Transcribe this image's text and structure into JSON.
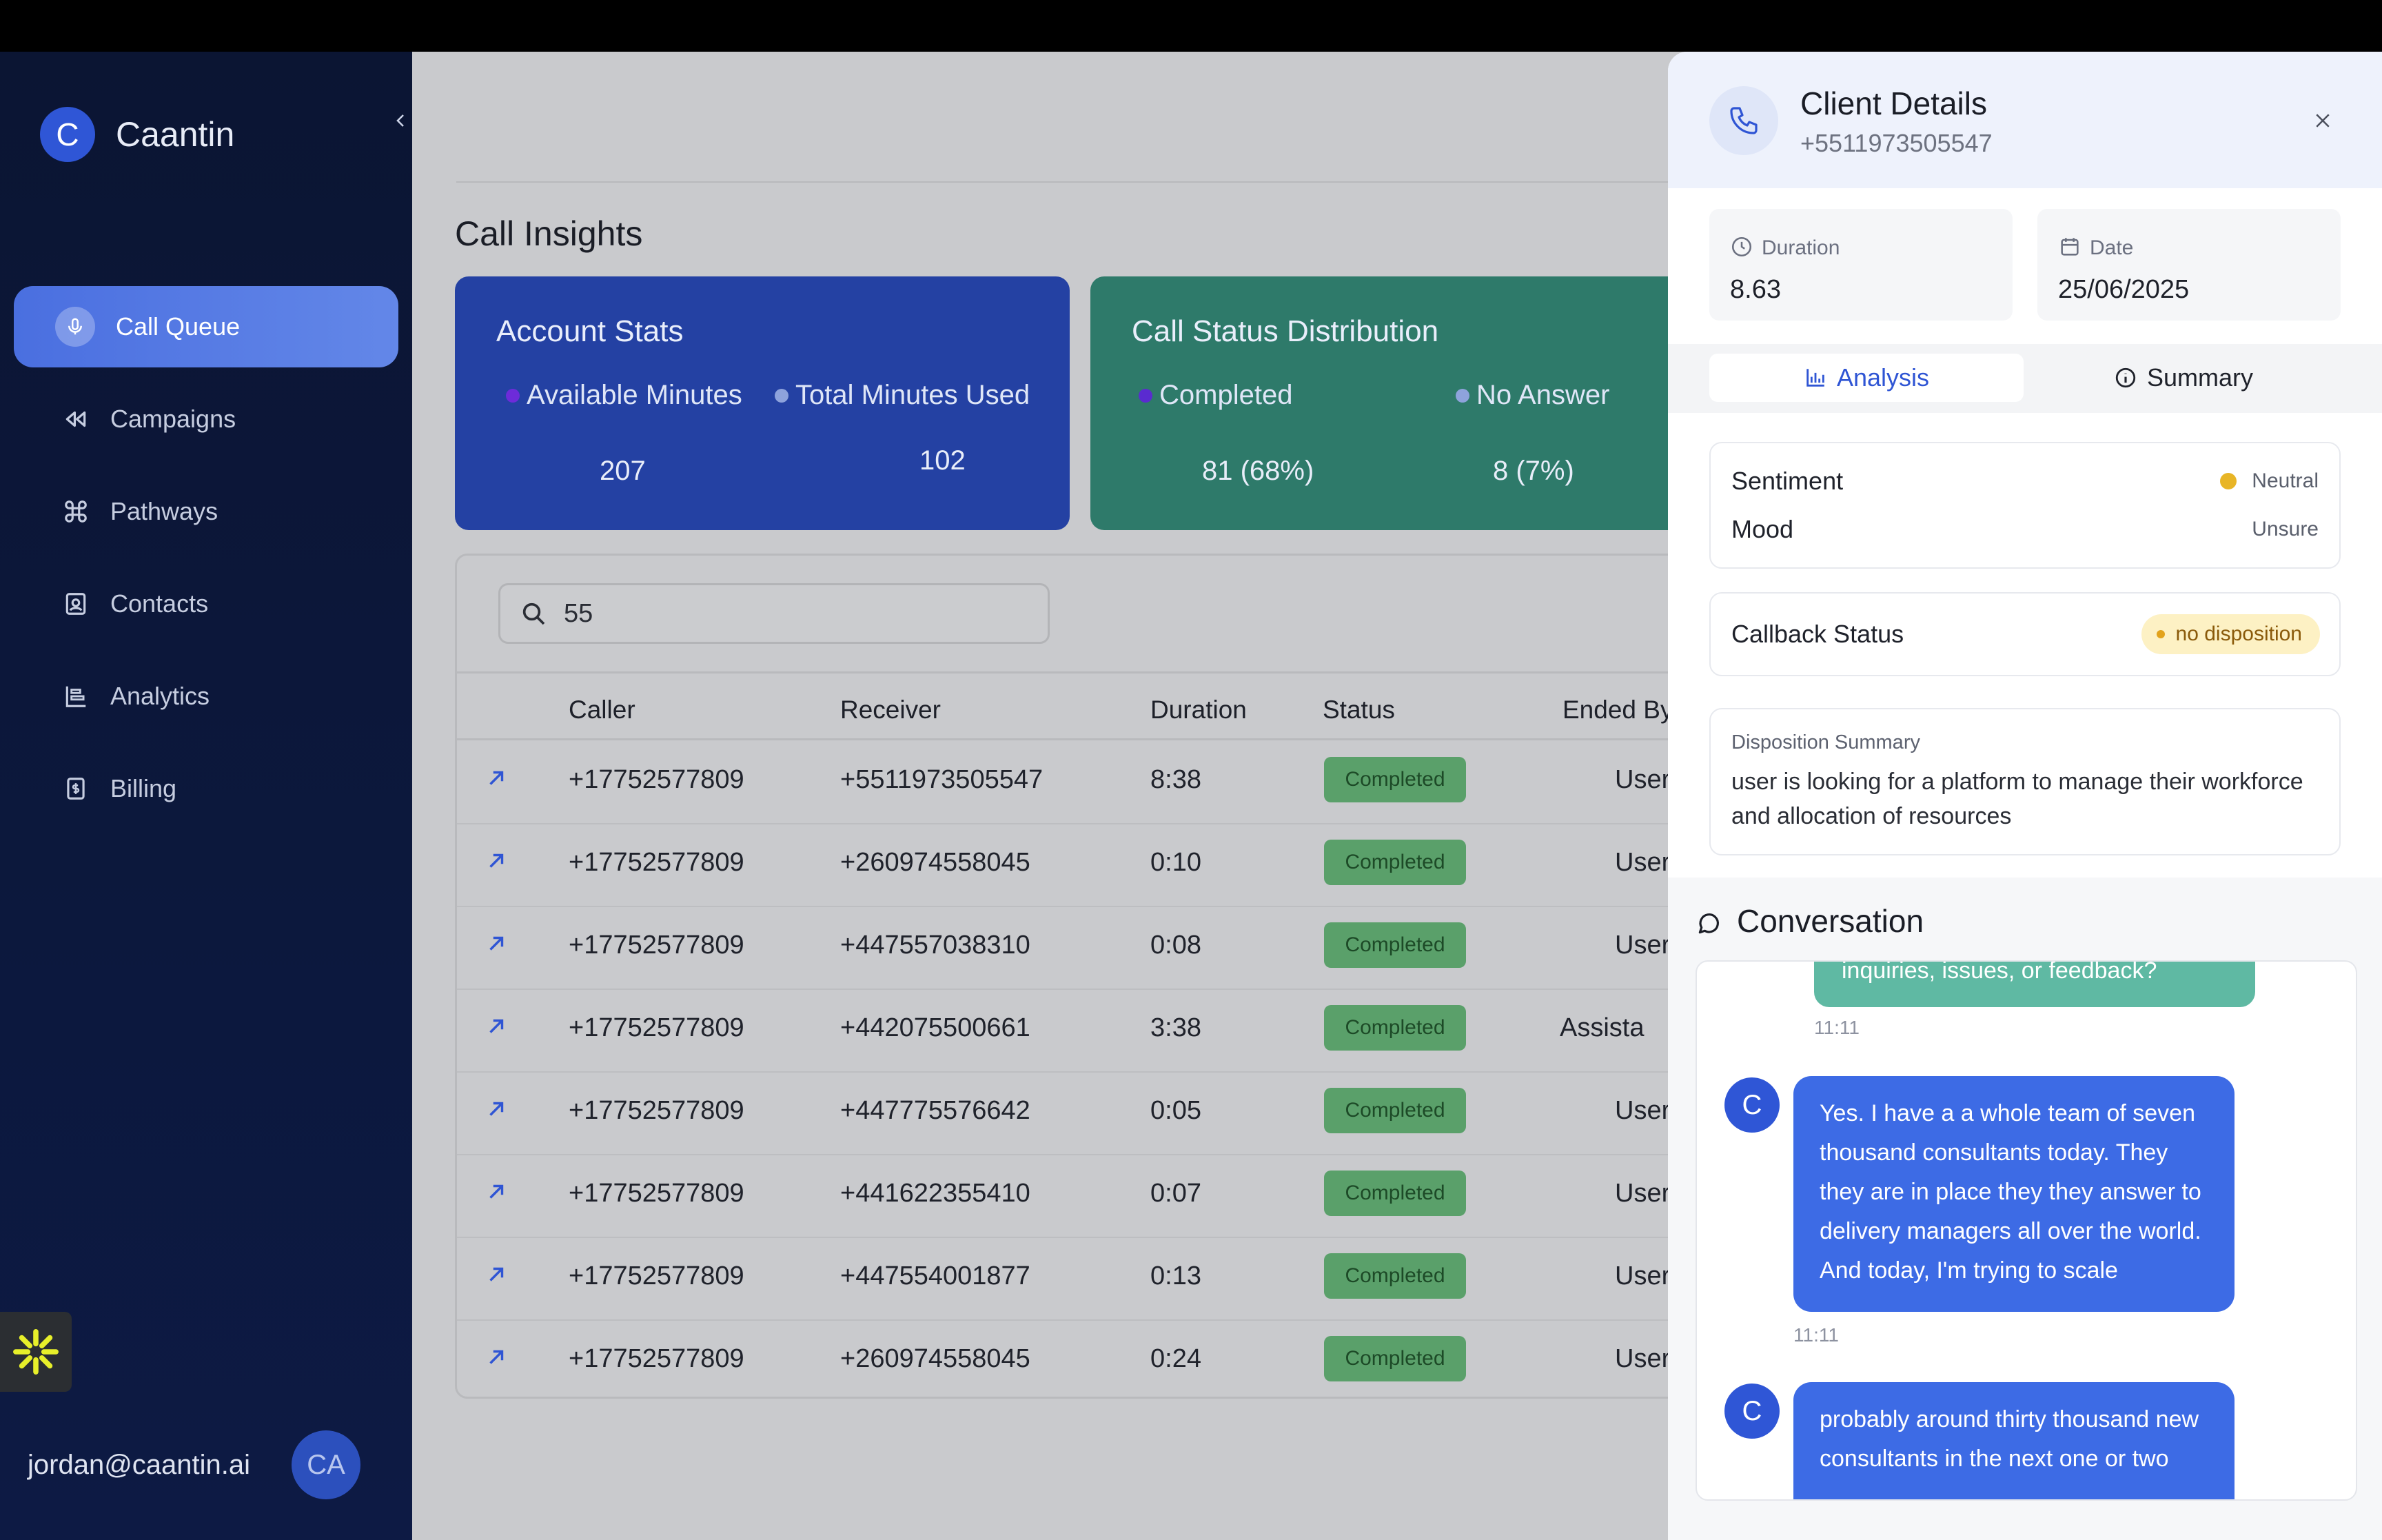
{
  "app": {
    "brand_initial": "C",
    "brand_name": "Caantin"
  },
  "sidebar": {
    "items": [
      {
        "label": "Call Queue",
        "icon": "mic-icon",
        "active": true
      },
      {
        "label": "Campaigns",
        "icon": "rewind-icon"
      },
      {
        "label": "Pathways",
        "icon": "command-icon"
      },
      {
        "label": "Contacts",
        "icon": "contact-card-icon"
      },
      {
        "label": "Analytics",
        "icon": "analytics-icon"
      },
      {
        "label": "Billing",
        "icon": "billing-icon"
      }
    ],
    "user_email": "jordan@caantin.ai",
    "user_initials": "CA"
  },
  "main": {
    "title": "Call Insights",
    "account_stats": {
      "title": "Account Stats",
      "legend": [
        {
          "label": "Available Minutes",
          "color": "#6d2bd9"
        },
        {
          "label": "Total Minutes Used",
          "color": "#8ea3dc"
        }
      ],
      "values": [
        "207",
        "102"
      ]
    },
    "call_status": {
      "title": "Call Status Distribution",
      "legend": [
        {
          "label": "Completed",
          "color": "#5a2bd0"
        },
        {
          "label": "No Answer",
          "color": "#8ea3dc"
        }
      ],
      "values": [
        "81 (68%)",
        "8 (7%)"
      ]
    },
    "search": {
      "value": "55"
    },
    "table": {
      "headers": [
        "Caller",
        "Receiver",
        "Duration",
        "Status",
        "Ended By"
      ],
      "rows": [
        {
          "caller": "+17752577809",
          "receiver": "+5511973505547",
          "duration": "8:38",
          "status": "Completed",
          "ended_by": "User"
        },
        {
          "caller": "+17752577809",
          "receiver": "+260974558045",
          "duration": "0:10",
          "status": "Completed",
          "ended_by": "User"
        },
        {
          "caller": "+17752577809",
          "receiver": "+447557038310",
          "duration": "0:08",
          "status": "Completed",
          "ended_by": "User"
        },
        {
          "caller": "+17752577809",
          "receiver": "+442075500661",
          "duration": "3:38",
          "status": "Completed",
          "ended_by": "Assista"
        },
        {
          "caller": "+17752577809",
          "receiver": "+447775576642",
          "duration": "0:05",
          "status": "Completed",
          "ended_by": "User"
        },
        {
          "caller": "+17752577809",
          "receiver": "+441622355410",
          "duration": "0:07",
          "status": "Completed",
          "ended_by": "User"
        },
        {
          "caller": "+17752577809",
          "receiver": "+447554001877",
          "duration": "0:13",
          "status": "Completed",
          "ended_by": "User"
        },
        {
          "caller": "+17752577809",
          "receiver": "+260974558045",
          "duration": "0:24",
          "status": "Completed",
          "ended_by": "User"
        }
      ]
    }
  },
  "panel": {
    "title": "Client Details",
    "phone": "+5511973505547",
    "duration_label": "Duration",
    "duration_value": "8.63",
    "date_label": "Date",
    "date_value": "25/06/2025",
    "tabs": {
      "analysis": "Analysis",
      "summary": "Summary"
    },
    "sentiment_label": "Sentiment",
    "sentiment_value": "Neutral",
    "mood_label": "Mood",
    "mood_value": "Unsure",
    "callback_label": "Callback Status",
    "callback_value": "no disposition",
    "disposition_label": "Disposition Summary",
    "disposition_text": "user is looking for a platform to manage their workforce and allocation of resources",
    "conversation_title": "Conversation",
    "messages": [
      {
        "text": "inquiries, issues, or feedback?",
        "time": "11:11"
      },
      {
        "avatar": "C",
        "text": "Yes. I have a a whole team of seven thousand consultants today. They they are in place they they answer to delivery managers all over the world. And today, I'm trying to scale",
        "time": "11:11"
      },
      {
        "avatar": "C",
        "text": "probably around thirty thousand new consultants in the next one or two"
      }
    ]
  }
}
